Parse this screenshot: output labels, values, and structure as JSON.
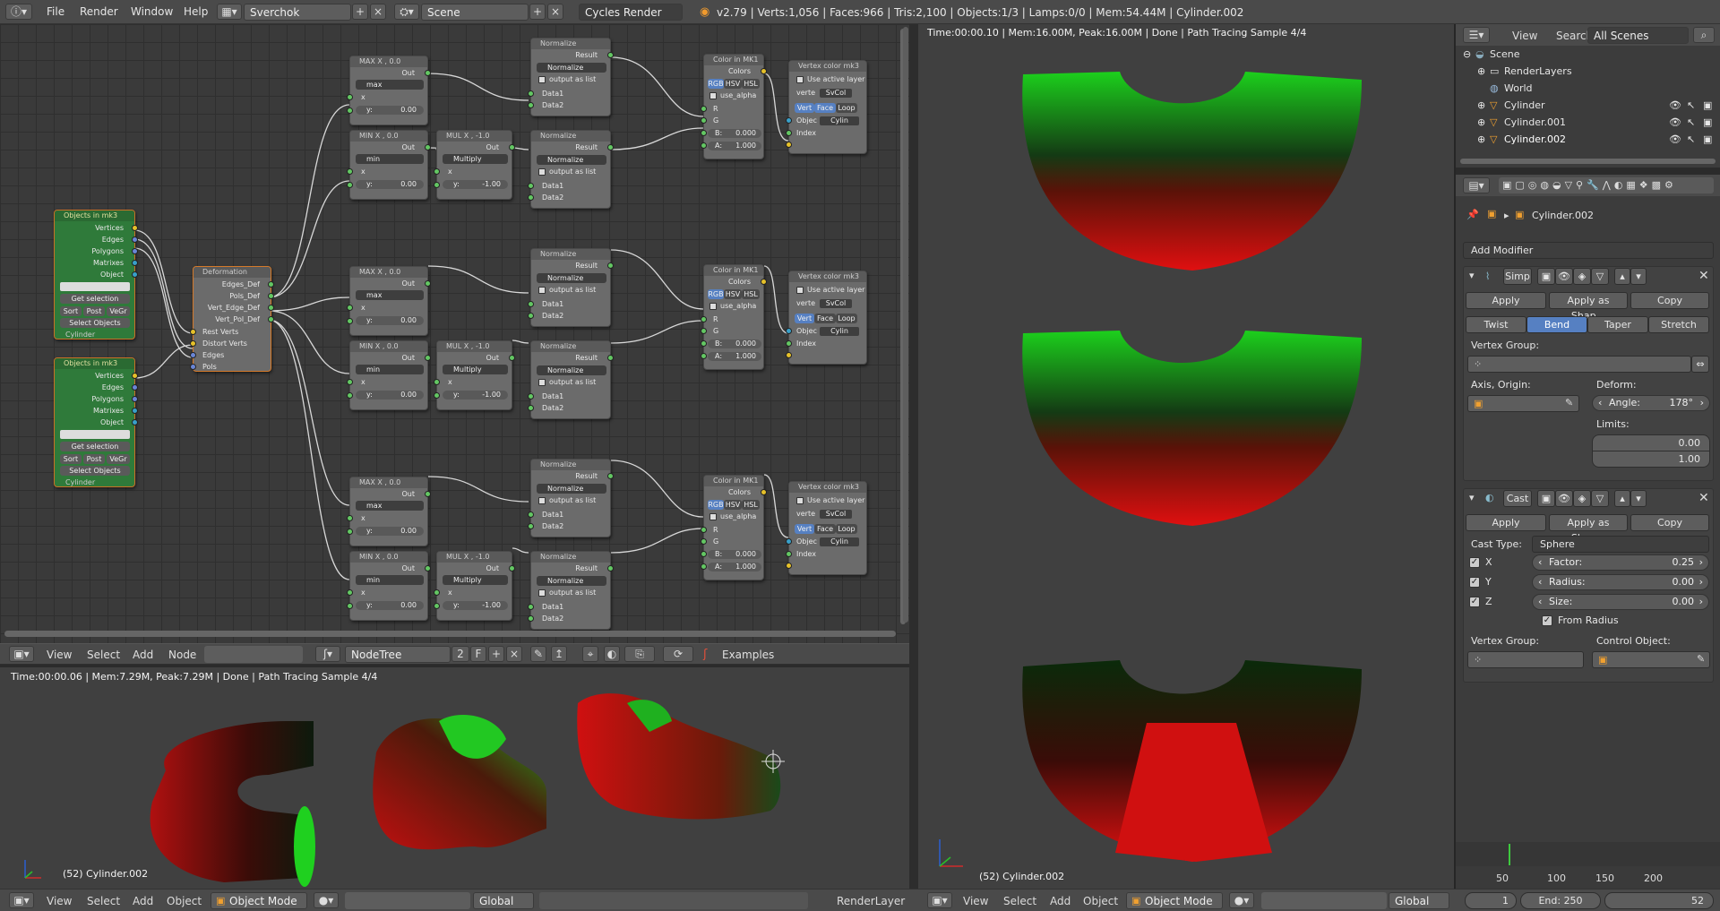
{
  "topbar": {
    "menus": [
      "File",
      "Render",
      "Window",
      "Help"
    ],
    "screen": "Sverchok",
    "scene": "Scene",
    "engine": "Cycles Render",
    "stats": "v2.79 | Verts:1,056 | Faces:966 | Tris:2,100 | Objects:1/3 | Lamps:0/0 | Mem:54.44M | Cylinder.002"
  },
  "nodes": {
    "objects_in_1": {
      "title": "Objects in mk3",
      "outputs": [
        "Vertices",
        "Edges",
        "Polygons",
        "Matrixes",
        "Object"
      ],
      "get_selection": "Get selection",
      "sort": "Sort",
      "post": "Post",
      "vegr": "VeGr",
      "select": "Select Objects",
      "obj": "Cylinder"
    },
    "objects_in_2": {
      "title": "Objects in mk3",
      "outputs": [
        "Vertices",
        "Edges",
        "Polygons",
        "Matrixes",
        "Object"
      ],
      "get_selection": "Get selection",
      "sort": "Sort",
      "post": "Post",
      "vegr": "VeGr",
      "select": "Select Objects",
      "obj": "Cylinder"
    },
    "deformation": {
      "title": "Deformation",
      "outputs": [
        "Edges_Def",
        "Pols_Def",
        "Vert_Edge_Def",
        "Vert_Pol_Def"
      ],
      "inputs": [
        "Rest Verts",
        "Distort Verts",
        "Edges",
        "Pols"
      ]
    },
    "max_title": "MAX X , 0.0",
    "min_title": "MIN X , 0.0",
    "mul_title": "MUL X , -1.0",
    "out": "Out",
    "max": "max",
    "min": "min",
    "multiply": "Multiply",
    "x": "x",
    "y_zero": "y:",
    "zero": "0.00",
    "neg_one": "-1.00",
    "normalize": "Normalize",
    "result": "Result",
    "output_as_list": "output as list",
    "data1": "Data1",
    "data2": "Data2",
    "color_title": "Color in MK1",
    "colors": "Colors",
    "rgb": "RGB",
    "hsv": "HSV",
    "hsl": "HSL",
    "use_alpha": "use_alpha",
    "r": "R",
    "g": "G",
    "b_label": "B:",
    "b_val": "0.000",
    "a_label": "A:",
    "a_val": "1.000",
    "vcol_title": "Vertex color mk3",
    "use_active_layer": "Use active layer",
    "verte": "verte",
    "svcol": "SvCol",
    "vert": "Vert",
    "face": "Face",
    "loop": "Loop",
    "objec": "Objec",
    "cylin": "Cylin",
    "index": "Index"
  },
  "node_header": {
    "menus": [
      "View",
      "Select",
      "Add",
      "Node"
    ],
    "tree": "NodeTree",
    "users": "2",
    "fake": "F",
    "examples": "Examples"
  },
  "vp_bottom": {
    "info": "Time:00:00.06 | Mem:7.29M, Peak:7.29M | Done | Path Tracing Sample 4/4",
    "object": "(52) Cylinder.002"
  },
  "vp_right": {
    "info": "Time:00:00.10 | Mem:16.00M, Peak:16.00M | Done | Path Tracing Sample 4/4",
    "object": "(52) Cylinder.002"
  },
  "outliner": {
    "menus": [
      "View",
      "Search"
    ],
    "filter": "All Scenes",
    "items": [
      "Scene",
      "RenderLayers",
      "World",
      "Cylinder",
      "Cylinder.001",
      "Cylinder.002"
    ]
  },
  "properties": {
    "object": "Cylinder.002",
    "add_modifier": "Add Modifier",
    "mod1": {
      "name": "Simp",
      "apply": "Apply",
      "apply_shape": "Apply as Shap...",
      "copy": "Copy",
      "modes": [
        "Twist",
        "Bend",
        "Taper",
        "Stretch"
      ],
      "active_mode": "Bend",
      "vertex_group": "Vertex Group:",
      "axis_origin": "Axis, Origin:",
      "deform": "Deform:",
      "angle_label": "Angle:",
      "angle": "178°",
      "limits": "Limits:",
      "limit_low": "0.00",
      "limit_high": "1.00"
    },
    "mod2": {
      "name": "Cast",
      "apply": "Apply",
      "apply_shape": "Apply as Shap...",
      "copy": "Copy",
      "cast_type_label": "Cast Type:",
      "cast_type": "Sphere",
      "x": "X",
      "y": "Y",
      "z": "Z",
      "factor_label": "Factor:",
      "factor": "0.25",
      "radius_label": "Radius:",
      "radius": "0.00",
      "size_label": "Size:",
      "size": "0.00",
      "from_radius": "From Radius",
      "vertex_group": "Vertex Group:",
      "control_object": "Control Object:"
    }
  },
  "timeline": {
    "ticks": [
      "50",
      "100",
      "150",
      "200"
    ],
    "start": "1",
    "end_label": "End:",
    "end": "250",
    "current": "52"
  },
  "bottombar": {
    "left_menus": [
      "View",
      "Select",
      "Add",
      "Object"
    ],
    "mode": "Object Mode",
    "orientation": "Global",
    "render_layer": "RenderLayer",
    "right_menus": [
      "View",
      "Select",
      "Add",
      "Object"
    ],
    "mode_right": "Object Mode",
    "orientation_right": "Global"
  }
}
